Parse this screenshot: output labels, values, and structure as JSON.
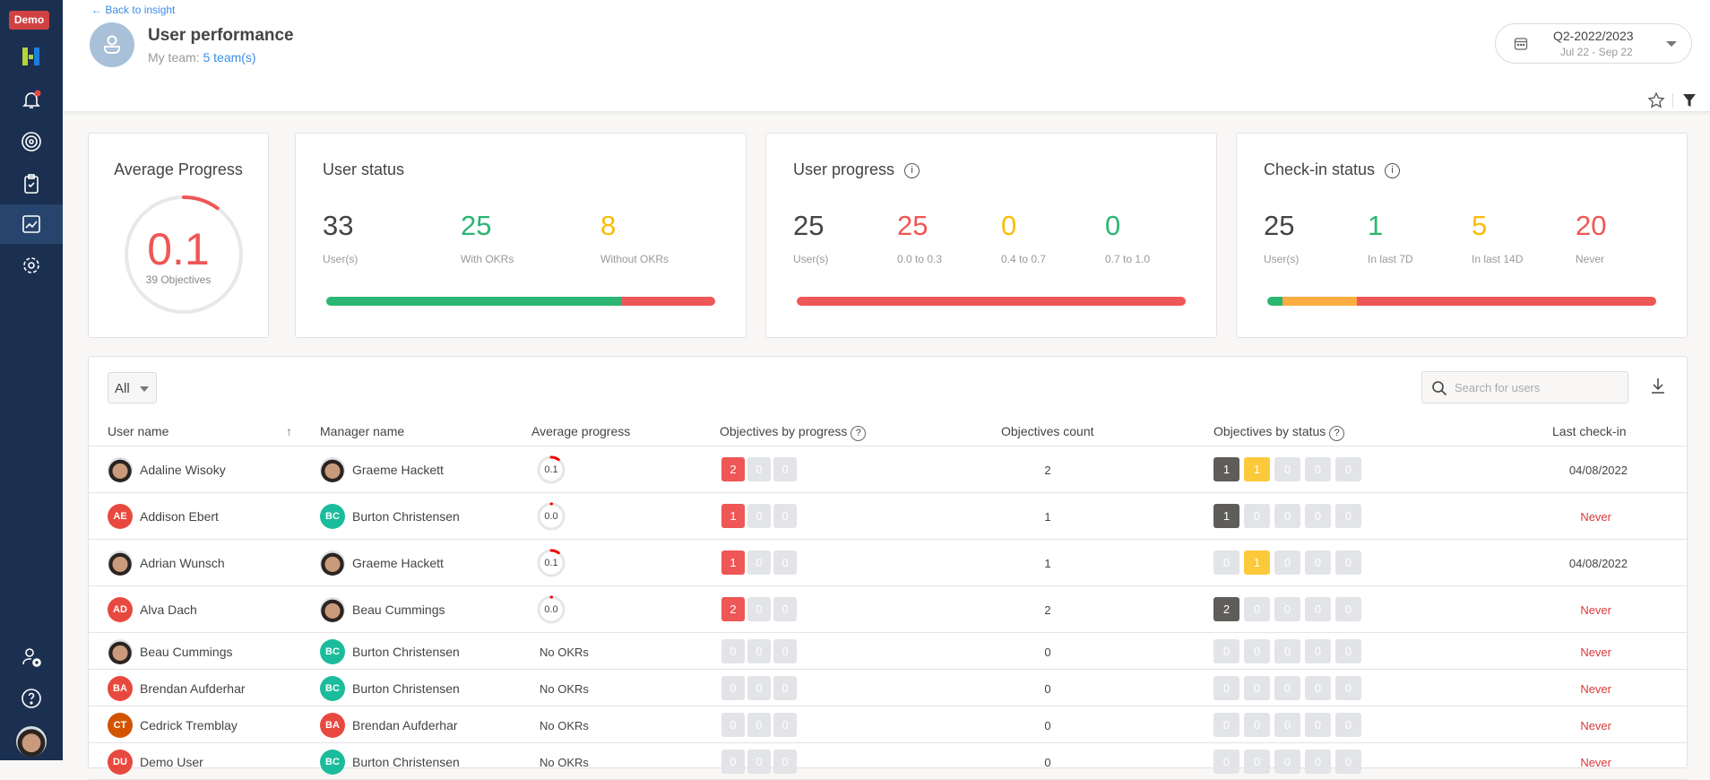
{
  "sidebar": {
    "demo_badge": "Demo",
    "items": [
      "logo-icon",
      "bell-icon",
      "target-icon",
      "clipboard-icon",
      "chart-icon",
      "gear-icon"
    ],
    "bottom": [
      "add-user-icon",
      "help-icon",
      "avatar"
    ]
  },
  "header": {
    "back_label": "Back to insight",
    "title": "User performance",
    "team_label": "My team:",
    "team_link": "5 team(s)",
    "period": "Q2-2022/2023",
    "period_range": "Jul 22 - Sep 22"
  },
  "cards": {
    "avg": {
      "title": "Average Progress",
      "value": "0.1",
      "progress": 0.1,
      "sub": "39 Objectives"
    },
    "user_status": {
      "title": "User status",
      "stats": [
        {
          "n": "33",
          "l": "User(s)",
          "c": "#444444"
        },
        {
          "n": "25",
          "l": "With OKRs",
          "c": "#2bb673"
        },
        {
          "n": "8",
          "l": "Without OKRs",
          "c": "#fbbc05"
        }
      ],
      "bar": [
        {
          "v": 25,
          "c": "#2bb673"
        },
        {
          "v": 8,
          "c": "#ef5656"
        }
      ]
    },
    "user_progress": {
      "title": "User progress",
      "stats": [
        {
          "n": "25",
          "l": "User(s)",
          "c": "#444444"
        },
        {
          "n": "25",
          "l": "0.0 to 0.3",
          "c": "#ef5656"
        },
        {
          "n": "0",
          "l": "0.4 to 0.7",
          "c": "#fbbc05"
        },
        {
          "n": "0",
          "l": "0.7 to 1.0",
          "c": "#2bb673"
        }
      ],
      "bar": [
        {
          "v": 25,
          "c": "#ef5656"
        }
      ]
    },
    "checkin": {
      "title": "Check-in status",
      "stats": [
        {
          "n": "25",
          "l": "User(s)",
          "c": "#444444"
        },
        {
          "n": "1",
          "l": "In last 7D",
          "c": "#2bb673"
        },
        {
          "n": "5",
          "l": "In last 14D",
          "c": "#fbbc05"
        },
        {
          "n": "20",
          "l": "Never",
          "c": "#ef5656"
        }
      ],
      "bar": [
        {
          "v": 1,
          "c": "#2bb673"
        },
        {
          "v": 5,
          "c": "#fbad41"
        },
        {
          "v": 20,
          "c": "#ef5656"
        }
      ]
    }
  },
  "table": {
    "filter": "All",
    "search_placeholder": "Search for users",
    "columns": [
      "User name",
      "Manager name",
      "Average progress",
      "Objectives by progress",
      "Objectives count",
      "Objectives by status",
      "Last check-in"
    ],
    "rows": [
      {
        "user": "Adaline Wisoky",
        "uinit": "",
        "ucolor": "photo",
        "manager": "Graeme Hackett",
        "minit": "",
        "mcolor": "photo",
        "avg": "0.1",
        "prog": [
          2,
          0,
          0
        ],
        "count": "2",
        "status": [
          1,
          1,
          0,
          0,
          0
        ],
        "last": "04/08/2022"
      },
      {
        "user": "Addison Ebert",
        "uinit": "AE",
        "ucolor": "#e8493f",
        "manager": "Burton Christensen",
        "minit": "BC",
        "mcolor": "#1abc9c",
        "avg": "0.0",
        "prog": [
          1,
          0,
          0
        ],
        "count": "1",
        "status": [
          1,
          0,
          0,
          0,
          0
        ],
        "last": "Never"
      },
      {
        "user": "Adrian Wunsch",
        "uinit": "",
        "ucolor": "photo",
        "manager": "Graeme Hackett",
        "minit": "",
        "mcolor": "photo",
        "avg": "0.1",
        "prog": [
          1,
          0,
          0
        ],
        "count": "1",
        "status": [
          0,
          1,
          0,
          0,
          0
        ],
        "last": "04/08/2022"
      },
      {
        "user": "Alva Dach",
        "uinit": "AD",
        "ucolor": "#e8493f",
        "manager": "Beau Cummings",
        "minit": "",
        "mcolor": "photo",
        "avg": "0.0",
        "prog": [
          2,
          0,
          0
        ],
        "count": "2",
        "status": [
          2,
          0,
          0,
          0,
          0
        ],
        "last": "Never"
      },
      {
        "user": "Beau Cummings",
        "uinit": "",
        "ucolor": "photo",
        "manager": "Burton Christensen",
        "minit": "BC",
        "mcolor": "#1abc9c",
        "avg": "No OKRs",
        "prog": [
          0,
          0,
          0
        ],
        "count": "0",
        "status": [
          0,
          0,
          0,
          0,
          0
        ],
        "last": "Never"
      },
      {
        "user": "Brendan Aufderhar",
        "uinit": "BA",
        "ucolor": "#e8493f",
        "manager": "Burton Christensen",
        "minit": "BC",
        "mcolor": "#1abc9c",
        "avg": "No OKRs",
        "prog": [
          0,
          0,
          0
        ],
        "count": "0",
        "status": [
          0,
          0,
          0,
          0,
          0
        ],
        "last": "Never"
      },
      {
        "user": "Cedrick Tremblay",
        "uinit": "CT",
        "ucolor": "#d35400",
        "manager": "Brendan Aufderhar",
        "minit": "BA",
        "mcolor": "#e8493f",
        "avg": "No OKRs",
        "prog": [
          0,
          0,
          0
        ],
        "count": "0",
        "status": [
          0,
          0,
          0,
          0,
          0
        ],
        "last": "Never"
      },
      {
        "user": "Demo User",
        "uinit": "DU",
        "ucolor": "#e8493f",
        "manager": "Burton Christensen",
        "minit": "BC",
        "mcolor": "#1abc9c",
        "avg": "No OKRs",
        "prog": [
          0,
          0,
          0
        ],
        "count": "0",
        "status": [
          0,
          0,
          0,
          0,
          0
        ],
        "last": "Never"
      }
    ]
  },
  "colors": {
    "red": "#ef5656",
    "dark": "#5f5d5a",
    "yellow": "#fcc93a",
    "empty": "#e3e4e8",
    "link": "#3b8ee8",
    "never": "#d93a3a"
  }
}
